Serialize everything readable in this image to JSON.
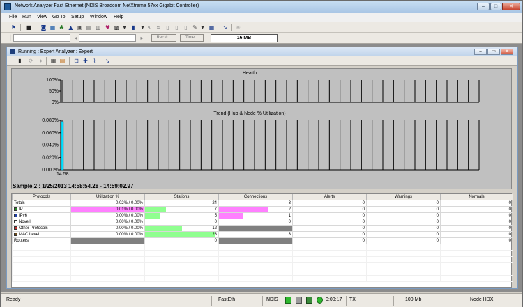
{
  "window": {
    "title": "Network Analyzer Fast Ethernet (NDIS Broadcom NetXtreme 57xx Gigabit Controller)",
    "minimize": "–",
    "maximize": "□",
    "close": "✕"
  },
  "menu": [
    "File",
    "Run",
    "View",
    "Go To",
    "Setup",
    "Window",
    "Help"
  ],
  "toolbar": {
    "record_field": "Rec #...",
    "time_button": "Time...",
    "buffer_size": "16 MB"
  },
  "child": {
    "title": "Running : Expert Analyzer : Expert",
    "minimize": "–",
    "restore": "▭",
    "close": "✕"
  },
  "health_chart": {
    "title": "Health",
    "ticks": [
      "100%",
      "50%",
      "0%"
    ]
  },
  "trend_chart": {
    "title": "Trend (Hub & Node % Utilization)",
    "ticks": [
      "0.080%",
      "0.060%",
      "0.040%",
      "0.020%",
      "0.000%"
    ],
    "x_label": "14:58"
  },
  "chart_data": [
    {
      "type": "bar",
      "title": "Health",
      "ylim": [
        0,
        100
      ],
      "yticks": [
        "100%",
        "50%",
        "0%"
      ],
      "values": []
    },
    {
      "type": "bar",
      "title": "Trend (Hub & Node % Utilization)",
      "ylim": [
        0,
        0.08
      ],
      "yticks": [
        "0.080%",
        "0.060%",
        "0.040%",
        "0.020%",
        "0.000%"
      ],
      "xticks": [
        "14:58"
      ],
      "values": [
        0.078
      ]
    }
  ],
  "sample": "Sample 2 : 1/25/2013 14:58:54.28 - 14:59:02.97",
  "table": {
    "headers": [
      "Protocols",
      "Utilization %",
      "Stations",
      "Connections",
      "Alerts",
      "Warnings",
      "Normals"
    ],
    "rows": [
      {
        "name": "Totals",
        "util": "0.02% / 0.00%",
        "stations": "24",
        "connections": "3",
        "alerts": "0",
        "warnings": "0",
        "normals": "0",
        "util_frac": 0,
        "st_frac": 0,
        "conn_frac": 0,
        "sq": ""
      },
      {
        "name": "IP",
        "util": "0.01% / 0.00%",
        "stations": "7",
        "connections": "2",
        "alerts": "0",
        "warnings": "0",
        "normals": "0",
        "util_frac": 1.0,
        "st_frac": 0.29,
        "conn_frac": 0.67,
        "sq": "#2a8a2a"
      },
      {
        "name": "IPv6",
        "util": "0.00% / 0.00%",
        "stations": "5",
        "connections": "1",
        "alerts": "0",
        "warnings": "0",
        "normals": "0",
        "util_frac": 0,
        "st_frac": 0.21,
        "conn_frac": 0.33,
        "sq": "#1d3fa8"
      },
      {
        "name": "Novell",
        "util": "0.00% / 0.00%",
        "stations": "0",
        "connections": "0",
        "alerts": "0",
        "warnings": "0",
        "normals": "0",
        "util_frac": 0,
        "st_frac": 0,
        "conn_frac": 0,
        "sq": "#ffffff"
      },
      {
        "name": "Other Protocols",
        "util": "0.00% / 0.00%",
        "stations": "12",
        "connections": "",
        "alerts": "0",
        "warnings": "0",
        "normals": "0",
        "util_frac": 0,
        "st_frac": 0.5,
        "conn_frac": 1.0,
        "sq": "#c03030"
      },
      {
        "name": "MAC Level",
        "util": "0.00% / 0.00%",
        "stations": "23",
        "connections": "3",
        "alerts": "0",
        "warnings": "0",
        "normals": "0",
        "util_frac": 0,
        "st_frac": 0.96,
        "conn_frac": 0,
        "sq": "#6a4a1a"
      },
      {
        "name": "Routers",
        "util": "",
        "stations": "0",
        "connections": "",
        "alerts": "0",
        "warnings": "0",
        "normals": "0",
        "util_frac": 1.0,
        "st_frac": 0,
        "conn_frac": 1.0,
        "sq": ""
      }
    ]
  },
  "colors": {
    "util_bar": "#ff80ff",
    "stations_bar": "#90ff90",
    "conn_bar": "#ff80ff",
    "gray_bar": "#808080",
    "trend_bar": "#00e0ff"
  },
  "status": {
    "ready": "Ready",
    "network": "FastEth",
    "driver": "NDIS",
    "elapsed": "0:00:17",
    "tx": "TX",
    "speed": "100 Mb",
    "mode": "Node HDX"
  }
}
